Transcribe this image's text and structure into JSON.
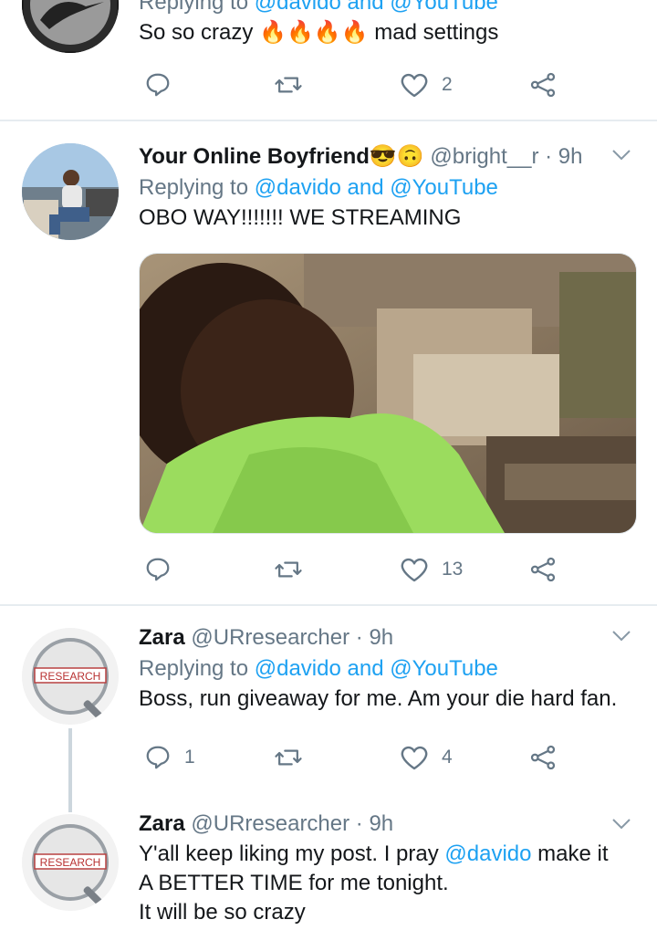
{
  "tweets": [
    {
      "reply_prefix": "Replying to",
      "reply_targets": "@davido and @YouTube",
      "text": "So so crazy",
      "emojis": [
        "fire",
        "fire",
        "fire",
        "fire"
      ],
      "text_after": "mad settings",
      "actions": {
        "reply_count": "",
        "retweet_count": "",
        "like_count": "2"
      }
    },
    {
      "name": "Your Online Boyfriend",
      "name_emojis": [
        "sunglasses-face",
        "upside-down-face"
      ],
      "handle": "@bright__r",
      "time": "· 9h",
      "reply_prefix": "Replying to",
      "reply_targets": "@davido and @YouTube",
      "text": "OBO WAY!!!!!!! WE STREAMING",
      "actions": {
        "reply_count": "",
        "retweet_count": "",
        "like_count": "13"
      }
    },
    {
      "name": "Zara",
      "handle": "@URresearcher",
      "time": "· 9h",
      "reply_prefix": "Replying to",
      "reply_targets": "@davido and @YouTube",
      "text": "Boss, run giveaway for me. Am your die hard fan.",
      "actions": {
        "reply_count": "1",
        "retweet_count": "",
        "like_count": "4"
      }
    },
    {
      "name": "Zara",
      "handle": "@URresearcher",
      "time": "· 9h",
      "text_before": "Y'all keep liking my post. I pray",
      "mention": "@davido",
      "text_after": "make it",
      "text_line2": "A BETTER TIME for me tonight.",
      "text_line3": "It will be so crazy"
    }
  ],
  "avatar_badge": {
    "word": "RESEARCH"
  },
  "colors": {
    "link": "#1da1f2",
    "muted": "#657786",
    "divider": "#e6ecf0"
  }
}
